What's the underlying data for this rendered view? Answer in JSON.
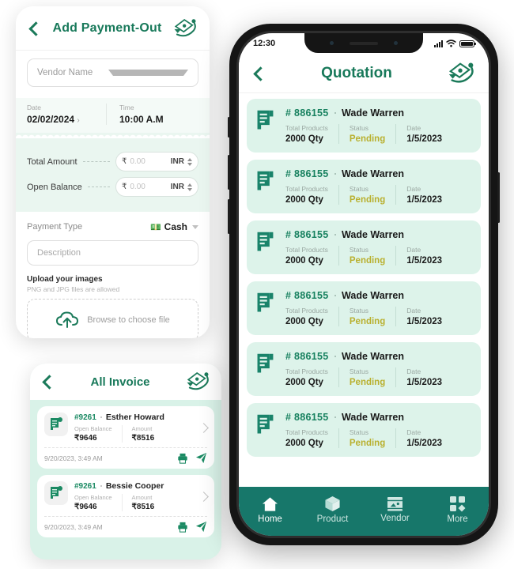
{
  "payout": {
    "title": "Add Payment-Out",
    "back_icon": "back-chevron-icon",
    "logo_icon": "app-logo-icon",
    "vendor_placeholder": "Vendor Name",
    "date_label": "Date",
    "date_value": "02/02/2024",
    "time_label": "Time",
    "time_value": "10:00 A.M",
    "total_amount_label": "Total Amount",
    "open_balance_label": "Open Balance",
    "currency_symbol": "₹",
    "amount_placeholder": "0.00",
    "currency_code": "INR",
    "payment_type_label": "Payment Type",
    "payment_type_value": "Cash",
    "payment_type_emoji": "💵",
    "description_placeholder": "Description",
    "upload_title": "Upload your images",
    "upload_sub": "PNG and JPG files are allowed",
    "browse_label": "Browse to choose file"
  },
  "invoice": {
    "title": "All Invoice",
    "back_icon": "back-chevron-icon",
    "logo_icon": "app-logo-icon",
    "col_open_balance": "Open Balance",
    "col_amount": "Amount",
    "items": [
      {
        "number": "#9261",
        "person": "Esther Howard",
        "open_balance": "₹9646",
        "amount": "₹8516",
        "timestamp": "9/20/2023, 3:49 AM"
      },
      {
        "number": "#9261",
        "person": "Bessie Cooper",
        "open_balance": "₹9646",
        "amount": "₹8516",
        "timestamp": "9/20/2023, 3:49 AM"
      }
    ]
  },
  "phone": {
    "status": {
      "time": "12:30",
      "signal_icon": "cellular-signal-icon",
      "wifi_icon": "wifi-icon",
      "battery_icon": "battery-icon"
    },
    "header": {
      "title": "Quotation",
      "back_icon": "back-chevron-icon",
      "logo_icon": "app-logo-icon"
    },
    "quotation_columns": {
      "total_products": "Total Products",
      "status": "Status",
      "date": "Date"
    },
    "quotations": [
      {
        "number": "# 886155",
        "person": "Wade Warren",
        "qty": "2000 Qty",
        "status": "Pending",
        "date": "1/5/2023"
      },
      {
        "number": "# 886155",
        "person": "Wade Warren",
        "qty": "2000 Qty",
        "status": "Pending",
        "date": "1/5/2023"
      },
      {
        "number": "# 886155",
        "person": "Wade Warren",
        "qty": "2000 Qty",
        "status": "Pending",
        "date": "1/5/2023"
      },
      {
        "number": "# 886155",
        "person": "Wade Warren",
        "qty": "2000 Qty",
        "status": "Pending",
        "date": "1/5/2023"
      },
      {
        "number": "# 886155",
        "person": "Wade Warren",
        "qty": "2000 Qty",
        "status": "Pending",
        "date": "1/5/2023"
      },
      {
        "number": "# 886155",
        "person": "Wade Warren",
        "qty": "2000 Qty",
        "status": "Pending",
        "date": "1/5/2023"
      }
    ],
    "nav": [
      {
        "label": "Home",
        "icon": "home-icon",
        "active": true
      },
      {
        "label": "Product",
        "icon": "box-icon",
        "active": false
      },
      {
        "label": "Vendor",
        "icon": "store-icon",
        "active": false
      },
      {
        "label": "More",
        "icon": "grid-icon",
        "active": false
      }
    ]
  },
  "colors": {
    "brand_green": "#18795a",
    "nav_teal": "#17776a",
    "card_mint": "#ddf3ea",
    "pending_olive": "#b9b02f"
  }
}
